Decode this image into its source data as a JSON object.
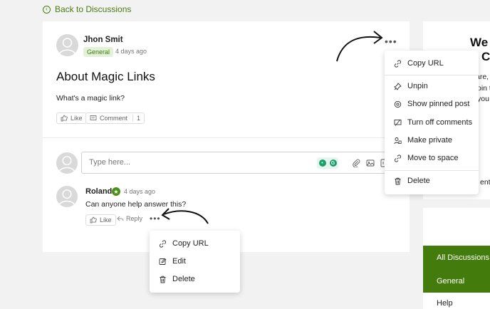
{
  "nav": {
    "back_label": "Back to Discussions"
  },
  "post": {
    "author": "Jhon Smit",
    "tag": "General",
    "time": "4 days ago",
    "title": "About Magic Links",
    "body": "What's a magic link?",
    "like_label": "Like",
    "comment_label": "Comment",
    "comment_count": "1"
  },
  "composer": {
    "placeholder": "Type here..."
  },
  "reply": {
    "author": "Roland",
    "time": "4 days ago",
    "text": "Can anyone help answer this?",
    "like_label": "Like",
    "reply_label": "Reply"
  },
  "post_menu": {
    "items": [
      {
        "label": "Copy URL",
        "icon": "link-icon"
      },
      {
        "label": "Unpin",
        "icon": "pin-icon"
      },
      {
        "label": "Show pinned post",
        "icon": "at-icon"
      },
      {
        "label": "Turn off comments",
        "icon": "comment-off-icon"
      },
      {
        "label": "Make private",
        "icon": "private-user-icon"
      },
      {
        "label": "Move to space",
        "icon": "link-icon"
      },
      {
        "label": "Delete",
        "icon": "trash-icon"
      }
    ]
  },
  "reply_menu": {
    "items": [
      {
        "label": "Copy URL",
        "icon": "link-icon"
      },
      {
        "label": "Edit",
        "icon": "edit-icon"
      },
      {
        "label": "Delete",
        "icon": "trash-icon"
      }
    ]
  },
  "sidebar": {
    "welcome_line1": "We",
    "welcome_line2": "C",
    "frag1": "are,",
    "frag2": "oin t",
    "frag3": "you",
    "frag4": "ent",
    "nav_items": [
      {
        "label": "All Discussions"
      },
      {
        "label": "General"
      },
      {
        "label": "Help"
      }
    ]
  },
  "colors": {
    "accent": "#4a7c12",
    "nav_bg": "#437c0d",
    "tag_bg": "#e3f1d8"
  }
}
